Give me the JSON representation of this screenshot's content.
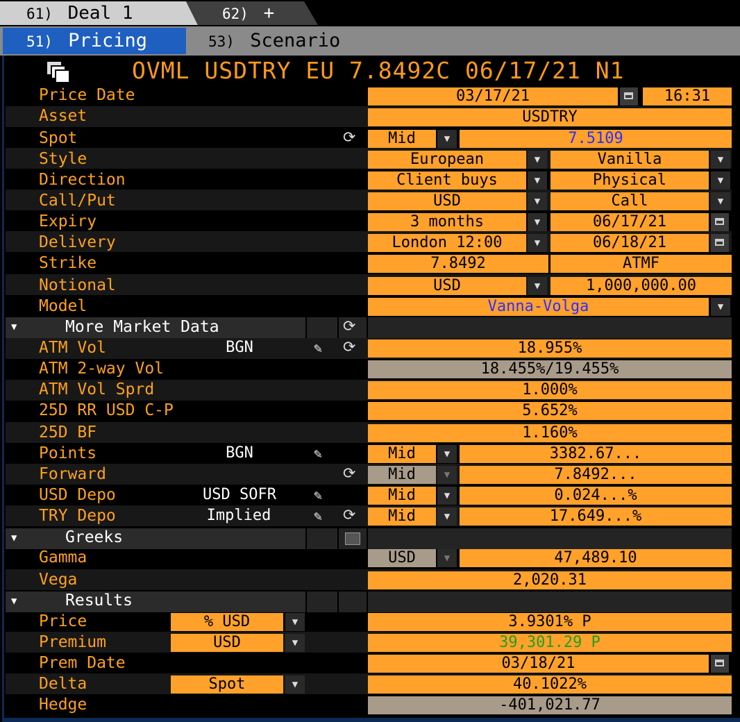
{
  "tabs": {
    "deal": {
      "num": "61)",
      "label": "Deal 1"
    },
    "new": {
      "num": "62)",
      "label": "+"
    },
    "pricing": {
      "num": "51)",
      "label": "Pricing"
    },
    "scenario": {
      "num": "53)",
      "label": "Scenario"
    }
  },
  "title": "OVML USDTRY EU 7.8492C 06/17/21 N1",
  "fields": {
    "price_date": {
      "label": "Price Date",
      "date": "03/17/21",
      "time": "16:31"
    },
    "asset": {
      "label": "Asset",
      "value": "USDTRY"
    },
    "spot": {
      "label": "Spot",
      "side": "Mid",
      "value": "7.5109"
    },
    "style": {
      "label": "Style",
      "v1": "European",
      "v2": "Vanilla"
    },
    "direction": {
      "label": "Direction",
      "v1": "Client buys",
      "v2": "Physical"
    },
    "callput": {
      "label": "Call/Put",
      "v1": "USD",
      "v2": "Call"
    },
    "expiry": {
      "label": "Expiry",
      "v1": "3 months",
      "v2": "06/17/21"
    },
    "delivery": {
      "label": "Delivery",
      "v1": "London 12:00",
      "v2": "06/18/21"
    },
    "strike": {
      "label": "Strike",
      "v1": "7.8492",
      "v2": "ATMF"
    },
    "notional": {
      "label": "Notional",
      "v1": "USD",
      "v2": "1,000,000.00"
    },
    "model": {
      "label": "Model",
      "value": "Vanna-Volga"
    }
  },
  "market": {
    "header": "More Market Data",
    "atm_vol": {
      "label": "ATM Vol",
      "src": "BGN",
      "value": "18.955%"
    },
    "atm_2way": {
      "label": "ATM 2-way Vol",
      "value": "18.455%/19.455%"
    },
    "atm_sprd": {
      "label": "ATM Vol Sprd",
      "value": "1.000%"
    },
    "rr": {
      "label": "25D RR USD C-P",
      "value": "5.652%"
    },
    "bf": {
      "label": "25D BF",
      "value": "1.160%"
    },
    "points": {
      "label": "Points",
      "src": "BGN",
      "side": "Mid",
      "value": "3382.67..."
    },
    "forward": {
      "label": "Forward",
      "side": "Mid",
      "value": "7.8492..."
    },
    "usd_depo": {
      "label": "USD Depo",
      "src": "USD SOFR",
      "side": "Mid",
      "value": "0.024...%"
    },
    "try_depo": {
      "label": "TRY Depo",
      "src": "Implied",
      "side": "Mid",
      "value": "17.649...%"
    }
  },
  "greeks": {
    "header": "Greeks",
    "gamma": {
      "label": "Gamma",
      "ccy": "USD",
      "value": "47,489.10"
    },
    "vega": {
      "label": "Vega",
      "value": "2,020.31"
    }
  },
  "results": {
    "header": "Results",
    "price": {
      "label": "Price",
      "unit": "% USD",
      "value": "3.9301% P"
    },
    "premium": {
      "label": "Premium",
      "unit": "USD",
      "value": "39,301.29 P"
    },
    "prem_date": {
      "label": "Prem Date",
      "value": "03/18/21"
    },
    "delta": {
      "label": "Delta",
      "unit": "Spot",
      "value": "40.1022%"
    },
    "hedge": {
      "label": "Hedge",
      "value": "-401,021.77"
    }
  },
  "colors": {
    "field": "#ffa12a",
    "label": "#ffa11d",
    "title": "#ff9a1a",
    "tab_active": "#1f5fc0",
    "link_blue": "#3030ff",
    "premium_green": "#20a020"
  }
}
